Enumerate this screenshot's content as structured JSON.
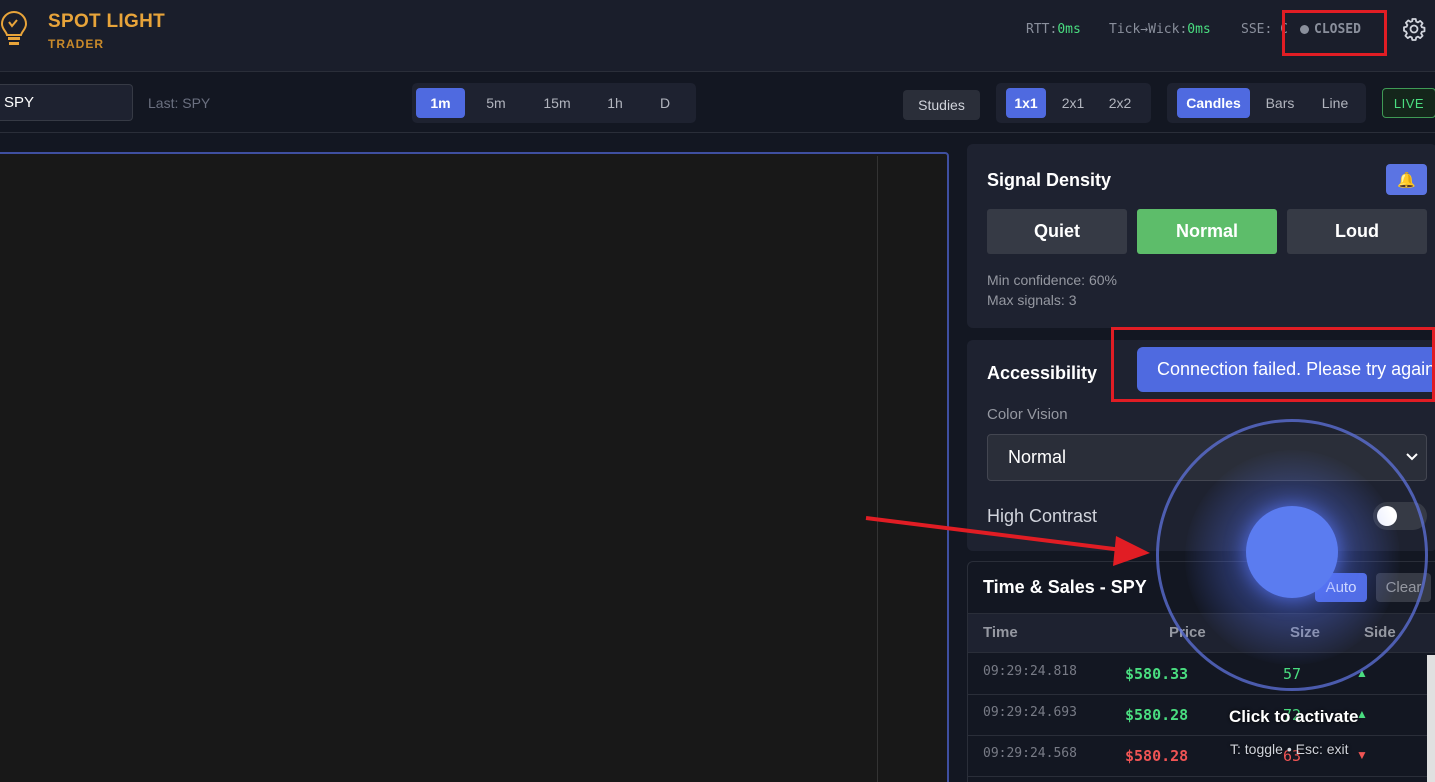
{
  "header": {
    "app_title": "SPOT LIGHT",
    "app_subtitle": "TRADER",
    "rtt_label": "RTT:",
    "rtt_value": "0ms",
    "tick_label": "Tick→Wick:",
    "tick_value": "0ms",
    "sse_label": "SSE:",
    "sse_value": "C",
    "connection_status": "CLOSED"
  },
  "toolbar": {
    "symbol_value": "SPY",
    "last_symbol": "Last: SPY",
    "timeframes": [
      "1m",
      "5m",
      "15m",
      "1h",
      "D"
    ],
    "active_timeframe": "1m",
    "studies_label": "Studies",
    "layouts": [
      "1x1",
      "2x1",
      "2x2"
    ],
    "active_layout": "1x1",
    "chart_types": [
      "Candles",
      "Bars",
      "Line"
    ],
    "active_chart_type": "Candles",
    "live_label": "LIVE"
  },
  "signal_density": {
    "title": "Signal Density",
    "bell_icon": "🔔",
    "options": [
      "Quiet",
      "Normal",
      "Loud"
    ],
    "active": "Normal",
    "min_confidence": "Min confidence: 60%",
    "max_signals": "Max signals: 3"
  },
  "accessibility": {
    "title": "Accessibility",
    "color_vision_label": "Color Vision",
    "color_vision_value": "Normal",
    "high_contrast_label": "High Contrast",
    "high_contrast_on": false
  },
  "toast": {
    "message": "Connection failed. Please try again."
  },
  "time_sales": {
    "title": "Time & Sales - SPY",
    "auto_label": "Auto",
    "clear_label": "Clear",
    "columns": [
      "Time",
      "Price",
      "Size",
      "Side"
    ],
    "rows": [
      {
        "time": "09:29:24.818",
        "price": "$580.33",
        "size": "57",
        "side": "▲",
        "dir": "up"
      },
      {
        "time": "09:29:24.693",
        "price": "$580.28",
        "size": "72",
        "side": "▲",
        "dir": "up"
      },
      {
        "time": "09:29:24.568",
        "price": "$580.28",
        "size": "63",
        "side": "▼",
        "dir": "down"
      }
    ]
  },
  "spotlight": {
    "click_label": "Click to activate",
    "hint": "T: toggle • Esc: exit"
  },
  "colors": {
    "accent": "#4f6ae0",
    "gold": "#e8a43a",
    "buy": "#4ade80",
    "sell": "#f05454",
    "annotation_red": "#e11d24"
  }
}
